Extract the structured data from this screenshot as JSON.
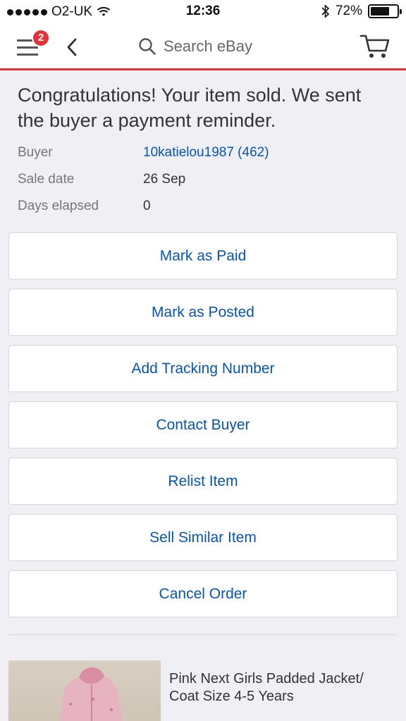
{
  "status_bar": {
    "carrier": "O2-UK",
    "time": "12:36",
    "battery": "72%",
    "battery_level": 0.72
  },
  "header": {
    "menu_badge": "2",
    "search_placeholder": "Search eBay",
    "icons": [
      "menu-icon",
      "back-chevron-icon",
      "search-icon",
      "cart-icon"
    ]
  },
  "sale": {
    "message": "Congratulations! Your item sold. We sent the buyer a payment reminder.",
    "details": [
      {
        "label": "Buyer",
        "value": "10katielou1987 (462)"
      },
      {
        "label": "Sale date",
        "value": "26 Sep"
      },
      {
        "label": "Days elapsed",
        "value": "0"
      }
    ]
  },
  "actions": [
    {
      "label": "Mark as Paid"
    },
    {
      "label": "Mark as Posted"
    },
    {
      "label": "Add Tracking Number"
    },
    {
      "label": "Contact Buyer"
    },
    {
      "label": "Relist Item"
    },
    {
      "label": "Sell Similar Item"
    },
    {
      "label": "Cancel Order"
    }
  ],
  "item": {
    "title": "Pink Next Girls Padded Jacket/ Coat Size 4-5 Years"
  },
  "colors": {
    "accent_red": "#e53238",
    "link_blue": "#0654ba",
    "background": "#efeff4"
  }
}
